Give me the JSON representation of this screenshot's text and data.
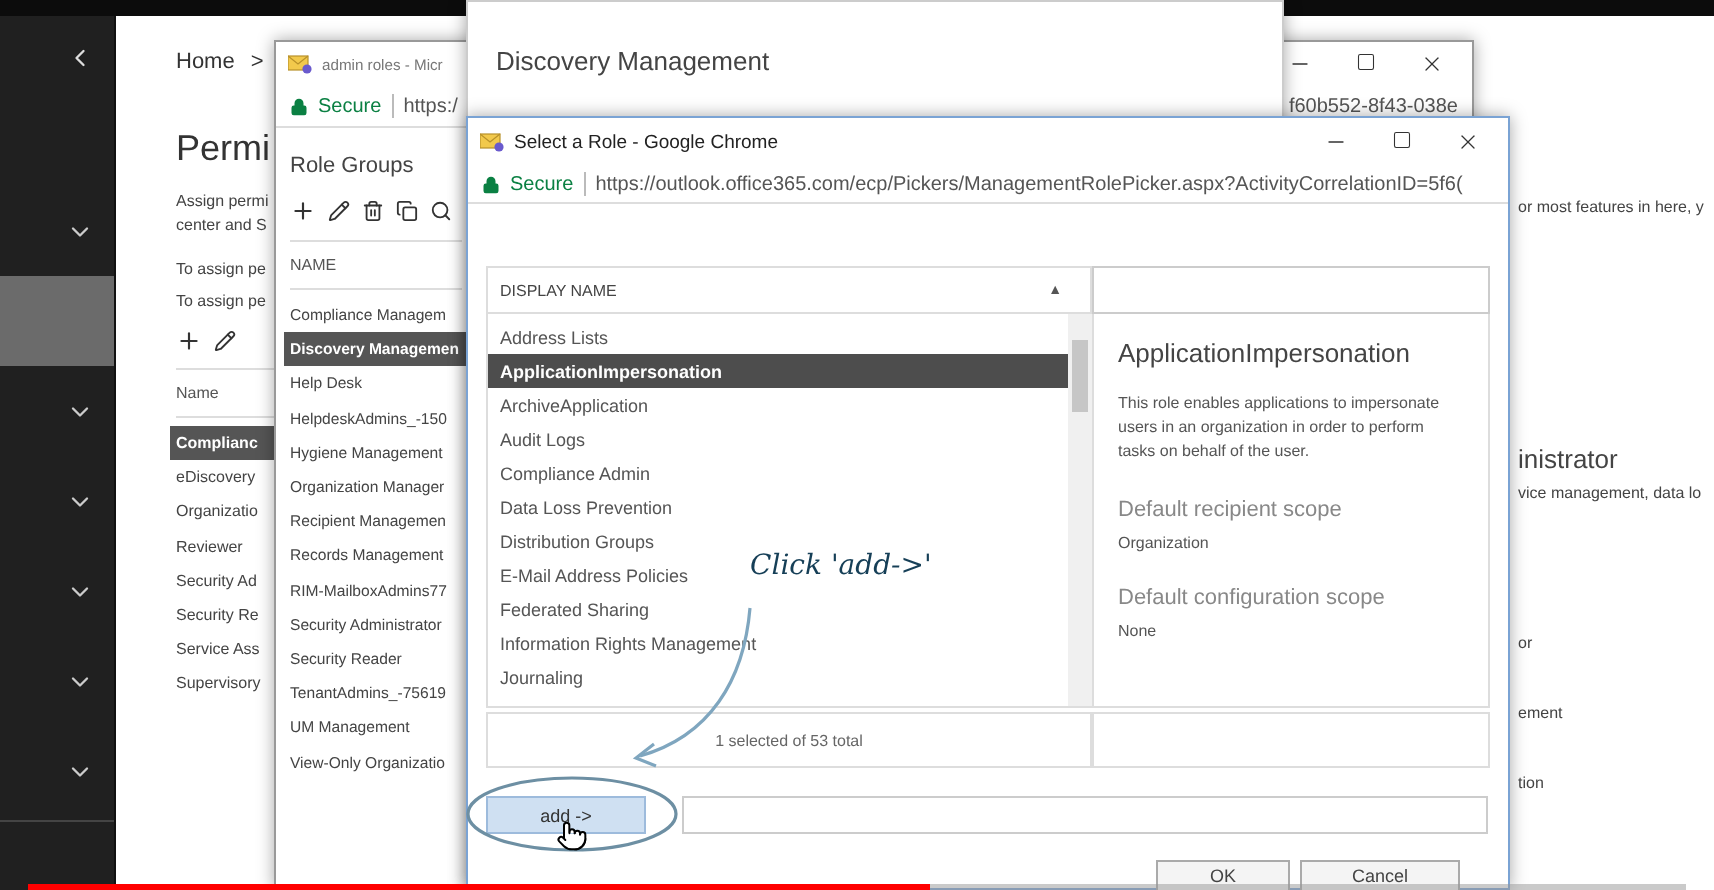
{
  "player": {
    "level": 0.544
  },
  "sidebar": {
    "items": [
      {
        "selected": false
      },
      {
        "selected": true
      },
      {
        "selected": false
      },
      {
        "selected": false
      },
      {
        "selected": false
      },
      {
        "selected": false
      },
      {
        "selected": false
      }
    ]
  },
  "page": {
    "breadcrumb": "Home",
    "breadcrumb_separator": ">",
    "title": "Permi",
    "description": [
      "Assign permi",
      "center and S"
    ],
    "notes": [
      "To assign pe",
      "To assign pe"
    ],
    "column_header": "Name",
    "rows": [
      {
        "name": "Complianc",
        "selected": true
      },
      {
        "name": "eDiscovery",
        "selected": false
      },
      {
        "name": "Organizatio",
        "selected": false
      },
      {
        "name": "Reviewer",
        "selected": false
      },
      {
        "name": "Security Ad",
        "selected": false
      },
      {
        "name": "Security Re",
        "selected": false
      },
      {
        "name": "Service Ass",
        "selected": false
      },
      {
        "name": "Supervisory",
        "selected": false
      }
    ],
    "top_right_text": "or most features in here, y",
    "detail_title": "inistrator",
    "detail_text": "vice management, data lo",
    "detail_items": [
      "or",
      "ement",
      "tion"
    ]
  },
  "admin_window": {
    "title": "admin roles - Micr",
    "secure_label": "Secure",
    "url": "https:/",
    "url_tail": "f60b552-8f43-038e",
    "heading": "Role Groups",
    "column_header": "NAME",
    "rows": [
      {
        "name": "Compliance Managem",
        "selected": false
      },
      {
        "name": "Discovery Managemen",
        "selected": true
      },
      {
        "name": "Help Desk",
        "selected": false
      },
      {
        "name": "HelpdeskAdmins_-150",
        "selected": false
      },
      {
        "name": "Hygiene Management",
        "selected": false
      },
      {
        "name": "Organization Manager",
        "selected": false
      },
      {
        "name": "Recipient Managemen",
        "selected": false
      },
      {
        "name": "Records Management",
        "selected": false
      },
      {
        "name": "RIM-MailboxAdmins77",
        "selected": false
      },
      {
        "name": "Security Administrator",
        "selected": false
      },
      {
        "name": "Security Reader",
        "selected": false
      },
      {
        "name": "TenantAdmins_-75619",
        "selected": false
      },
      {
        "name": "UM Management",
        "selected": false
      },
      {
        "name": "View-Only Organizatio",
        "selected": false
      }
    ]
  },
  "discovery_window": {
    "title": "Discovery Management"
  },
  "role_picker": {
    "title": "Select a Role - Google Chrome",
    "secure_label": "Secure",
    "url": "https://outlook.office365.com/ecp/Pickers/ManagementRolePicker.aspx?ActivityCorrelationID=5f6(",
    "column_header": "DISPLAY NAME",
    "sort_indicator": "▲",
    "rows": [
      {
        "name": "Address Lists",
        "selected": false
      },
      {
        "name": "ApplicationImpersonation",
        "selected": true
      },
      {
        "name": "ArchiveApplication",
        "selected": false
      },
      {
        "name": "Audit Logs",
        "selected": false
      },
      {
        "name": "Compliance Admin",
        "selected": false
      },
      {
        "name": "Data Loss Prevention",
        "selected": false
      },
      {
        "name": "Distribution Groups",
        "selected": false
      },
      {
        "name": "E-Mail Address Policies",
        "selected": false
      },
      {
        "name": "Federated Sharing",
        "selected": false
      },
      {
        "name": "Information Rights Management",
        "selected": false
      },
      {
        "name": "Journaling",
        "selected": false
      }
    ],
    "status": "1 selected of 53 total",
    "detail": {
      "title": "ApplicationImpersonation",
      "description": "This role enables applications to impersonate users in an organization in order to perform tasks on behalf of the user.",
      "sections": [
        {
          "label": "Default recipient scope",
          "value": "Organization"
        },
        {
          "label": "Default configuration scope",
          "value": "None"
        }
      ]
    },
    "add_button": "add ->",
    "ok_button": "OK",
    "cancel_button": "Cancel"
  },
  "annotation": {
    "text": "Click 'add->'"
  }
}
